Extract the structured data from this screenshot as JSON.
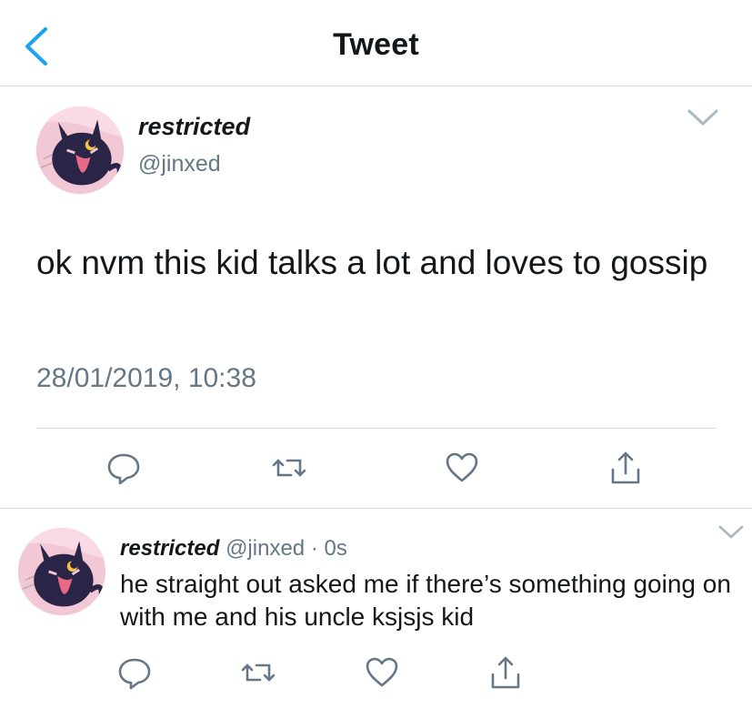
{
  "navbar": {
    "title": "Tweet",
    "back_icon": "chevron-left-icon"
  },
  "tweet": {
    "display_name": "restricted",
    "handle": "@jinxed",
    "text": "ok nvm this kid talks a lot and loves to gossip",
    "timestamp": "28/01/2019, 10:38",
    "actions": [
      "reply-icon",
      "retweet-icon",
      "like-icon",
      "share-icon"
    ]
  },
  "reply": {
    "display_name": "restricted",
    "handle": "@jinxed",
    "separator": "·",
    "time": "0s",
    "text": "he straight out asked me if there’s something going on with me and his uncle ksjsjs kid",
    "actions": [
      "reply-icon",
      "retweet-icon",
      "like-icon",
      "share-icon"
    ]
  },
  "colors": {
    "accent": "#1da1f2",
    "text": "#14171a",
    "secondary": "#657786",
    "divider": "#d7dbdf",
    "avatar_bg": "#f3c8d6",
    "cat": "#2a2547"
  }
}
